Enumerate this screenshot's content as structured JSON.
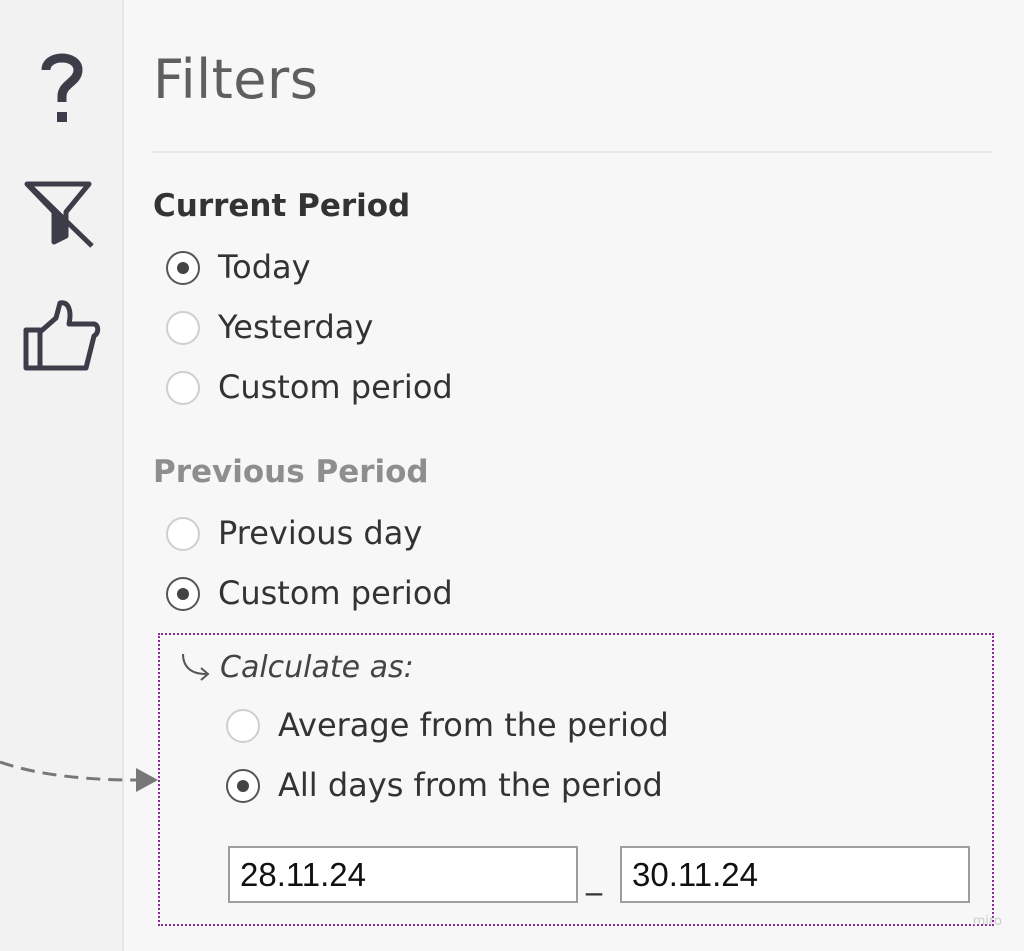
{
  "sidebar": {
    "icons": [
      "help-icon",
      "clear-filter-icon",
      "thumbs-up-icon"
    ]
  },
  "panel": {
    "title": "Filters",
    "current_period": {
      "label": "Current Period",
      "options": [
        {
          "label": "Today",
          "checked": true
        },
        {
          "label": "Yesterday",
          "checked": false
        },
        {
          "label": "Custom period",
          "checked": false
        }
      ]
    },
    "previous_period": {
      "label": "Previous Period",
      "options": [
        {
          "label": "Previous day",
          "checked": false
        },
        {
          "label": "Custom period",
          "checked": true
        }
      ]
    },
    "calculate": {
      "label": "Calculate as:",
      "options": [
        {
          "label": "Average from the period",
          "checked": false
        },
        {
          "label": "All days from the period",
          "checked": true
        }
      ],
      "date_from": "28.11.24",
      "separator": "_",
      "date_to": "30.11.24"
    }
  },
  "watermark": "miro",
  "colors": {
    "highlight_border": "#8a2a9a",
    "section_active": "#333333",
    "section_muted": "#8e8e8e",
    "title": "#5f5f5f"
  }
}
